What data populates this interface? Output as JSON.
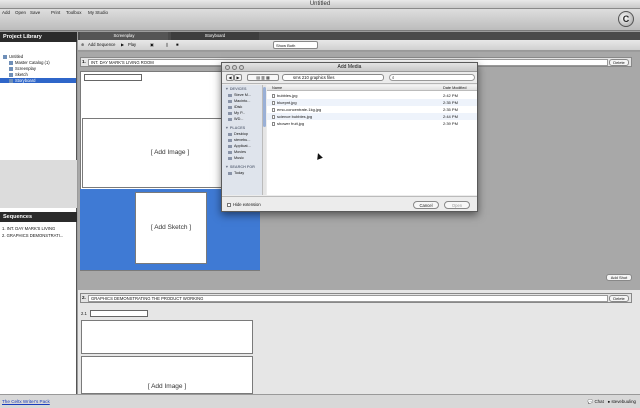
{
  "window": {
    "title": "Untitled"
  },
  "app_toolbar": {
    "items": [
      "Add",
      "Open",
      "Save",
      "Print",
      "Toolbox",
      "My Studio"
    ],
    "logo_glyph": "C"
  },
  "project_library": {
    "header": "Project Library",
    "items": [
      "Untitled",
      "Master Catalog (1)",
      "Screenplay",
      "Sketch",
      "Storyboard"
    ]
  },
  "sequences": {
    "header": "Sequences",
    "items": [
      "1. INT. DAY MARK'S LIVING",
      "2. GRAPHICS DEMONSTRATI..."
    ]
  },
  "tabs": {
    "screenplay": "Screenplay",
    "storyboard": "Storyboard"
  },
  "sub_toolbar": {
    "add_sequence": "Add Sequence",
    "play": "Play",
    "show_both": "Show Both"
  },
  "scene1": {
    "number": "1.",
    "title": "INT. DAY MARK'S LIVING ROOM",
    "delete": "Delete",
    "add_image": "[ Add Image ]",
    "add_sketch": "[ Add Sketch ]",
    "add_shot": "Add Shot"
  },
  "scene2": {
    "number": "2.",
    "title": "GRAPHICS DEMONSTRATING THE PRODUCT WORKING",
    "delete": "Delete",
    "frame_label": "2.1",
    "add_image": "[ Add Image ]"
  },
  "dialog": {
    "title": "Add Media",
    "nav_back": "◀",
    "nav_forward": "▶",
    "folder": "sms 210 graphics files",
    "sidebar": {
      "devices_head": "▼ DEVICES",
      "devices": [
        "Steve M...",
        "Macinto...",
        "iDisk",
        "My P...",
        "WD..."
      ],
      "places_head": "▼ PLACES",
      "places": [
        "Desktop",
        "stevebu...",
        "Applicat...",
        "Movies",
        "Music"
      ],
      "search_head": "▼ SEARCH FOR",
      "search": [
        "Today"
      ]
    },
    "columns": {
      "name": "Name",
      "date": "Date Modified"
    },
    "files": [
      {
        "name": "bubbles.jpg",
        "date": "2:42 PM"
      },
      {
        "name": "bluepnt.jpg",
        "date": "2:35 PM"
      },
      {
        "name": "emo-concentrate-1kg.jpg",
        "date": "2:35 PM"
      },
      {
        "name": "science bubbles.jpg",
        "date": "2:44 PM"
      },
      {
        "name": "shower fruit.jpg",
        "date": "2:39 PM"
      }
    ],
    "hide_extension": "Hide extension",
    "cancel": "Cancel",
    "open": "Open"
  },
  "status_bar": {
    "link": "The Celtx Writer's Pack",
    "chat": "Chat",
    "user": "stevebuuling"
  }
}
